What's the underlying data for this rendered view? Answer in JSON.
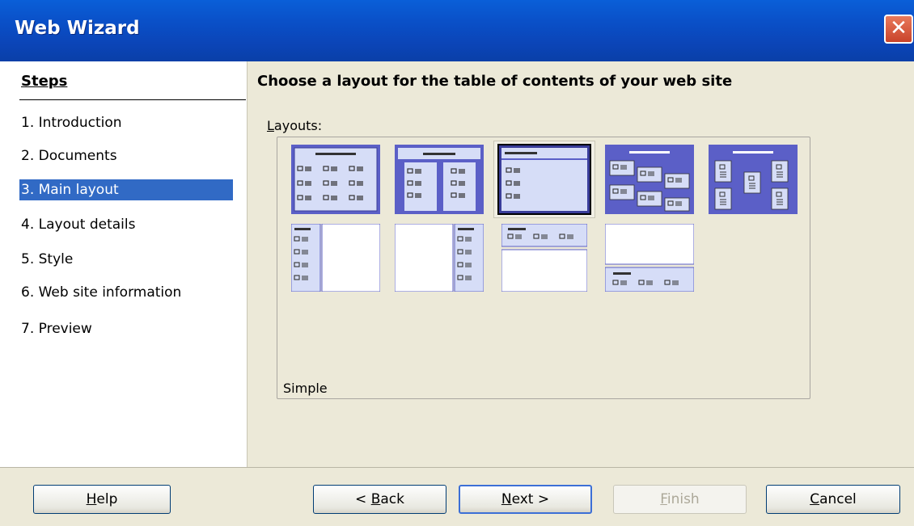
{
  "window": {
    "title": "Web Wizard",
    "close_icon": "close-icon"
  },
  "steps": {
    "heading": "Steps",
    "items": [
      {
        "label": "1.  Introduction",
        "active": false
      },
      {
        "label": "2.  Documents",
        "active": false
      },
      {
        "label": "3.  Main layout",
        "active": true
      },
      {
        "label": "4.  Layout details",
        "active": false
      },
      {
        "label": "5.  Style",
        "active": false
      },
      {
        "label": "6.  Web site information",
        "active": false
      },
      {
        "label": "7.  Preview",
        "active": false
      }
    ]
  },
  "main": {
    "title": "Choose a layout for the table of contents of your web site",
    "layouts_label_mnemonic": "L",
    "layouts_label_rest": "ayouts:",
    "selected_layout_name": "Simple",
    "layouts": [
      {
        "name": "layout-1",
        "selected": false
      },
      {
        "name": "layout-2",
        "selected": false
      },
      {
        "name": "layout-3",
        "selected": true
      },
      {
        "name": "layout-4",
        "selected": false
      },
      {
        "name": "layout-5",
        "selected": false
      },
      {
        "name": "layout-6",
        "selected": false
      },
      {
        "name": "layout-7",
        "selected": false
      },
      {
        "name": "layout-8",
        "selected": false
      },
      {
        "name": "layout-9",
        "selected": false
      }
    ]
  },
  "buttons": {
    "help": {
      "mn": "H",
      "rest": "elp"
    },
    "back": {
      "pre": "< ",
      "mn": "B",
      "rest": "ack"
    },
    "next": {
      "mn": "N",
      "rest": "ext >"
    },
    "finish": {
      "mn": "F",
      "rest": "inish"
    },
    "cancel": {
      "mn": "C",
      "rest": "ancel"
    }
  },
  "colors": {
    "accent": "#316ac5",
    "titlebar": "#0a50c8",
    "thumb_dark": "#5b5fc7",
    "thumb_light": "#d6ddf7"
  }
}
